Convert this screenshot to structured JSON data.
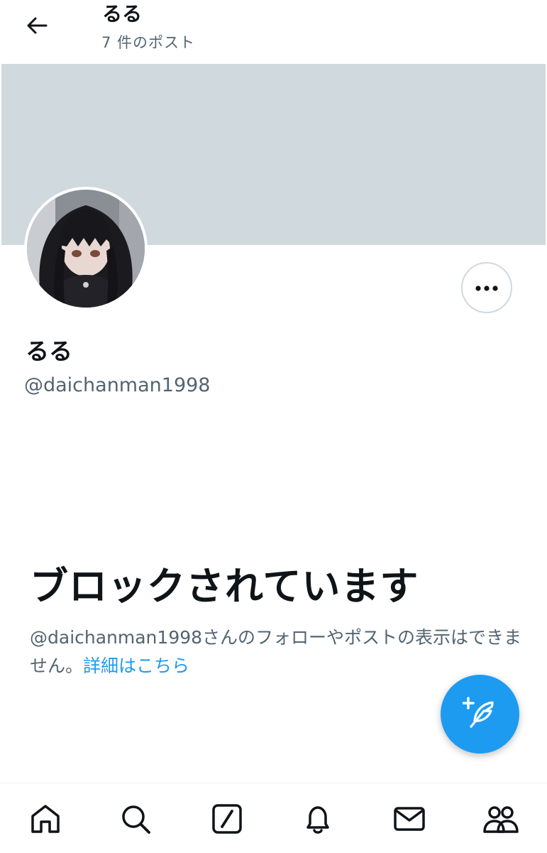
{
  "header": {
    "title": "るる",
    "subtitle": "7 件のポスト",
    "back_icon": "arrow-left-icon"
  },
  "profile": {
    "banner_color": "#cfd9de",
    "avatar_icon": "avatar-anime-girl",
    "display_name": "るる",
    "handle": "@daichanman1998",
    "more_icon": "more-horizontal-icon"
  },
  "blocked": {
    "title": "ブロックされています",
    "description": "@daichanman1998さんのフォローやポストの表示はできません。",
    "link_text": "詳細はこちら"
  },
  "fab": {
    "icon": "compose-feather-plus-icon",
    "color": "#1d9bf0"
  },
  "bottom_nav": {
    "items": [
      {
        "icon": "home-icon"
      },
      {
        "icon": "search-icon"
      },
      {
        "icon": "grok-icon"
      },
      {
        "icon": "bell-icon"
      },
      {
        "icon": "mail-icon"
      },
      {
        "icon": "communities-icon"
      }
    ]
  },
  "colors": {
    "text_primary": "#0f1419",
    "text_secondary": "#536471",
    "link": "#1d9bf0"
  }
}
